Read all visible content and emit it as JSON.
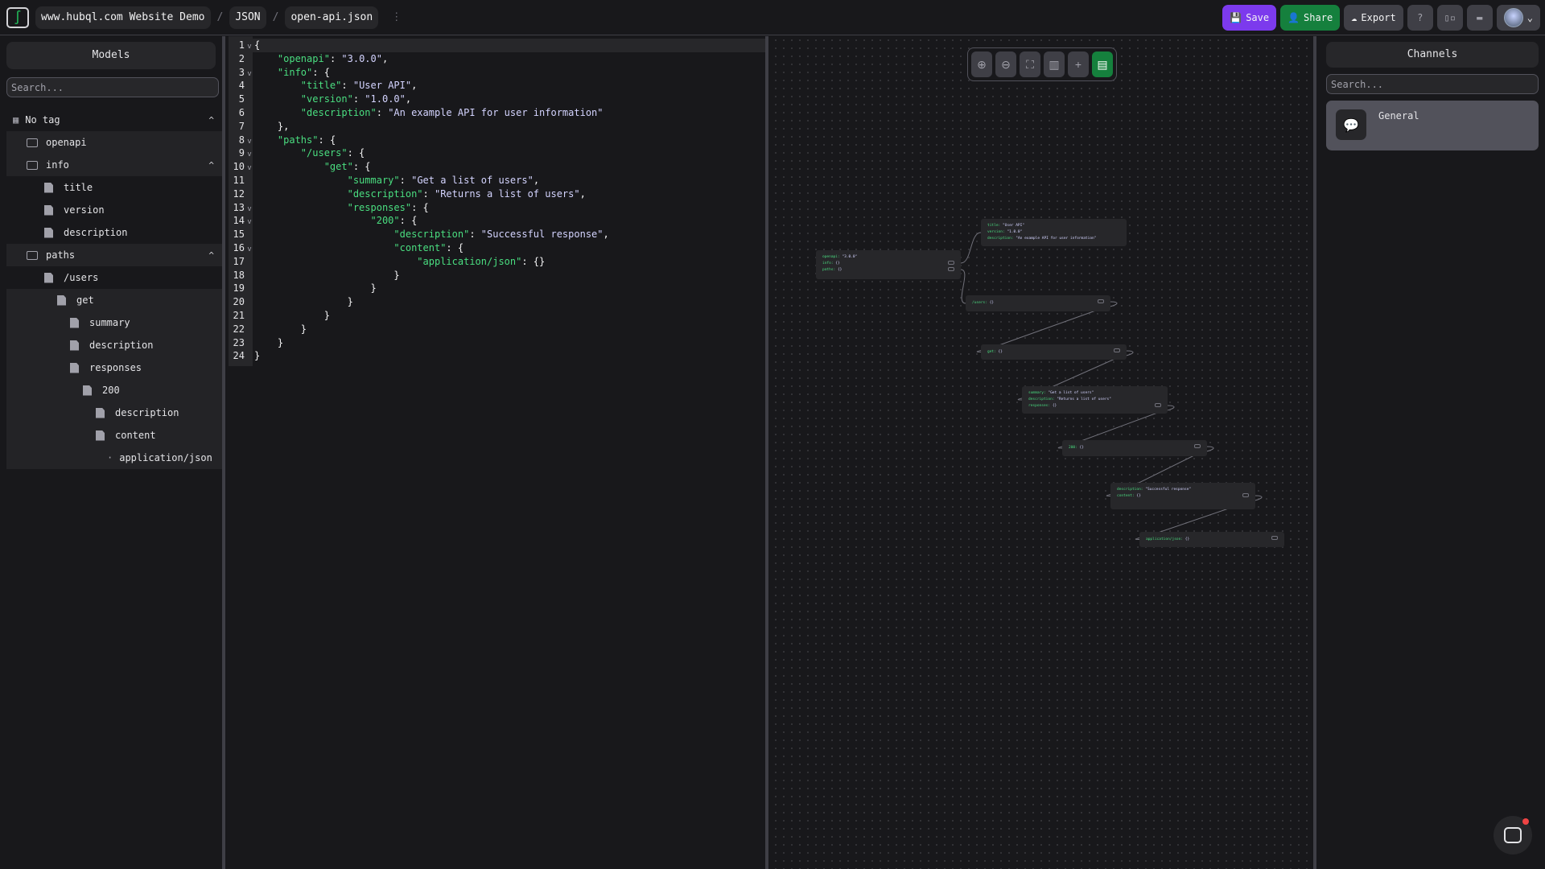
{
  "header": {
    "breadcrumbs": [
      "www.hubql.com Website Demo",
      "JSON",
      "open-api.json"
    ],
    "separator": "/",
    "more": "⋮",
    "buttons": {
      "save": "Save",
      "share": "Share",
      "export": "Export"
    },
    "colors": {
      "save": "#7c3aed",
      "share": "#15803d"
    }
  },
  "models": {
    "title": "Models",
    "search_placeholder": "Search...",
    "tree": [
      {
        "label": "No tag",
        "icon": "table-icon",
        "depth": 0,
        "expanded": true,
        "hl": false
      },
      {
        "label": "openapi",
        "icon": "folder-icon",
        "depth": 1,
        "hl": true
      },
      {
        "label": "info",
        "icon": "folder-icon",
        "depth": 1,
        "expanded": true,
        "hl": true
      },
      {
        "label": "title",
        "icon": "file-icon",
        "depth": 2
      },
      {
        "label": "version",
        "icon": "file-icon",
        "depth": 2
      },
      {
        "label": "description",
        "icon": "file-icon",
        "depth": 2
      },
      {
        "label": "paths",
        "icon": "folder-icon",
        "depth": 1,
        "expanded": true,
        "hl": true
      },
      {
        "label": "/users",
        "icon": "file-icon",
        "depth": 2
      },
      {
        "label": "get",
        "icon": "file-icon",
        "depth": 3,
        "hl": true
      },
      {
        "label": "summary",
        "icon": "file-icon",
        "depth": 4,
        "hl": true
      },
      {
        "label": "description",
        "icon": "file-icon",
        "depth": 4,
        "hl": true
      },
      {
        "label": "responses",
        "icon": "file-icon",
        "depth": 4,
        "hl": true
      },
      {
        "label": "200",
        "icon": "file-icon",
        "depth": 5,
        "hl": true
      },
      {
        "label": "description",
        "icon": "file-icon",
        "depth": 6,
        "hl": true
      },
      {
        "label": "content",
        "icon": "file-icon",
        "depth": 6,
        "hl": true
      },
      {
        "label": "application/json",
        "icon": "dot-icon",
        "depth": 7,
        "hl": true
      }
    ]
  },
  "editor": {
    "lines": [
      "{",
      "    \"openapi\": \"3.0.0\",",
      "    \"info\": {",
      "        \"title\": \"User API\",",
      "        \"version\": \"1.0.0\",",
      "        \"description\": \"An example API for user information\"",
      "    },",
      "    \"paths\": {",
      "        \"/users\": {",
      "            \"get\": {",
      "                \"summary\": \"Get a list of users\",",
      "                \"description\": \"Returns a list of users\",",
      "                \"responses\": {",
      "                    \"200\": {",
      "                        \"description\": \"Successful response\",",
      "                        \"content\": {",
      "                            \"application/json\": {}",
      "                        }",
      "                    }",
      "                }",
      "            }",
      "        }",
      "    }",
      "}"
    ],
    "foldable": [
      1,
      3,
      8,
      9,
      10,
      13,
      14,
      16
    ],
    "active_line": 1
  },
  "graph": {
    "toolbar": [
      "zoom-in-icon",
      "zoom-out-icon",
      "fit-view-icon",
      "map-icon",
      "plus-icon",
      "document-icon"
    ],
    "nodes": [
      {
        "id": "root",
        "rows": [
          [
            "openapi",
            "\"3.0.0\""
          ],
          [
            "info",
            "{}"
          ],
          [
            "paths",
            "{}"
          ]
        ]
      },
      {
        "id": "info",
        "rows": [
          [
            "title",
            "\"User API\""
          ],
          [
            "version",
            "\"1.0.0\""
          ],
          [
            "description",
            "\"An example API for user information\""
          ]
        ]
      },
      {
        "id": "users",
        "rows": [
          [
            "/users",
            "{}"
          ]
        ]
      },
      {
        "id": "get",
        "rows": [
          [
            "get",
            "{}"
          ]
        ]
      },
      {
        "id": "getbody",
        "rows": [
          [
            "summary",
            "\"Get a list of users\""
          ],
          [
            "description",
            "\"Returns a list of users\""
          ],
          [
            "responses",
            "{}"
          ]
        ]
      },
      {
        "id": "r200",
        "rows": [
          [
            "200",
            "{}"
          ]
        ]
      },
      {
        "id": "resp",
        "rows": [
          [
            "description",
            "\"Successful response\""
          ],
          [
            "content",
            "{}"
          ]
        ]
      },
      {
        "id": "appjson",
        "rows": [
          [
            "application/json",
            "{}"
          ]
        ]
      }
    ]
  },
  "channels": {
    "title": "Channels",
    "search_placeholder": "Search...",
    "items": [
      {
        "name": "General",
        "icon": "chat-bubbles-icon"
      }
    ]
  }
}
